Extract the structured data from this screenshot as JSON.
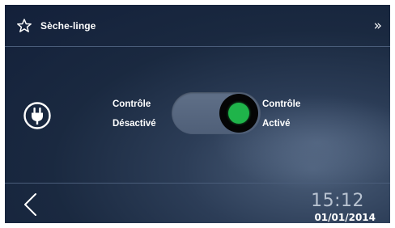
{
  "header": {
    "title": "Sèche-linge",
    "favorite_icon": "star-outline-icon",
    "forward_icon": "double-chevron-right-icon",
    "forward_glyph": "»"
  },
  "device": {
    "icon": "plug-icon"
  },
  "control": {
    "off_label_line1": "Contrôle",
    "off_label_line2": "Désactivé",
    "on_label_line1": "Contrôle",
    "on_label_line2": "Activé",
    "state": "on",
    "led_color": "#1fb44a"
  },
  "footer": {
    "back_icon": "chevron-left-icon",
    "time": "15:12",
    "date": "01/01/2014"
  },
  "colors": {
    "background": "#1a2940",
    "divider": "#4a5d7a",
    "track": "#56667f"
  }
}
